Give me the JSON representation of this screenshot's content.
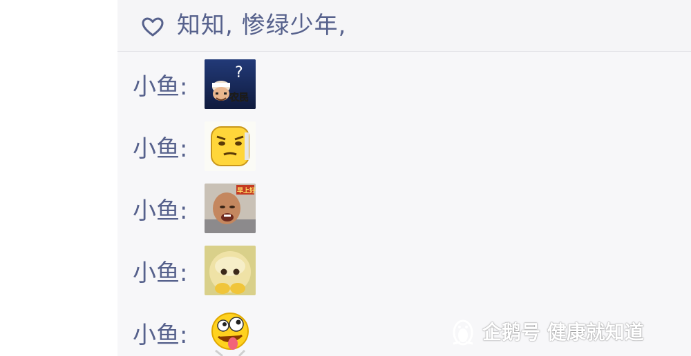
{
  "likes": {
    "icon": "heart-outline-icon",
    "text": "知知, 惨绿少年,"
  },
  "comments": [
    {
      "author": "小鱼:",
      "sticker": "confused-farmer-sticker",
      "sticker_text": "农民"
    },
    {
      "author": "小鱼:",
      "sticker": "speechless-face-sticker"
    },
    {
      "author": "小鱼:",
      "sticker": "bald-man-laughing-sticker",
      "sticker_text": "早上好"
    },
    {
      "author": "小鱼:",
      "sticker": "teletubby-face-sticker"
    },
    {
      "author": "小鱼:",
      "sticker": "crazy-tongue-emoji-sticker"
    }
  ],
  "watermark": {
    "icon": "penguin-icon",
    "text": "企鹅号 健康就知道"
  },
  "colors": {
    "name_text": "#56618c",
    "panel_bg": "#f7f7f9",
    "page_bg": "#ffffff"
  }
}
